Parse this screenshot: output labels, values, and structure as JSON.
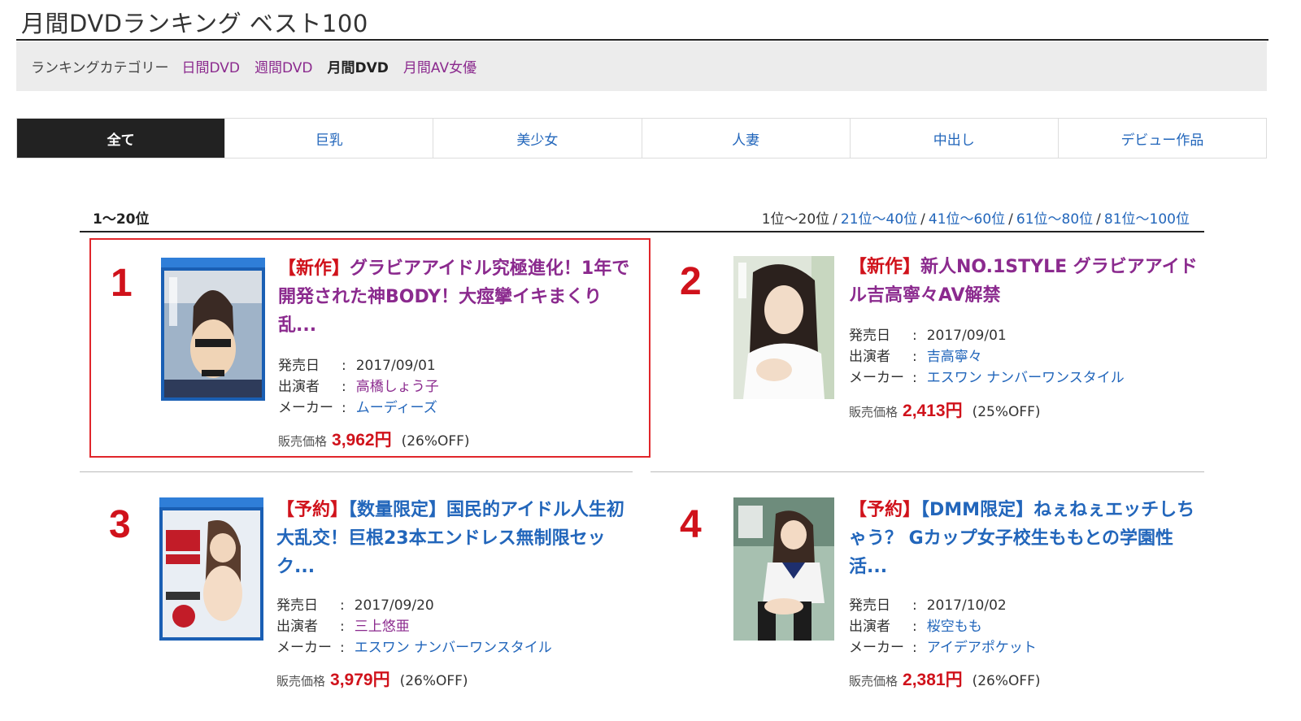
{
  "page": {
    "title": "月間DVDランキング ベスト100"
  },
  "category_bar": {
    "label": "ランキングカテゴリー",
    "items": [
      {
        "label": "日間DVD",
        "active": false
      },
      {
        "label": "週間DVD",
        "active": false
      },
      {
        "label": "月間DVD",
        "active": true
      },
      {
        "label": "月間AV女優",
        "active": false
      }
    ]
  },
  "genre_tabs": [
    {
      "label": "全て",
      "active": true
    },
    {
      "label": "巨乳",
      "active": false
    },
    {
      "label": "美少女",
      "active": false
    },
    {
      "label": "人妻",
      "active": false
    },
    {
      "label": "中出し",
      "active": false
    },
    {
      "label": "デビュー作品",
      "active": false
    }
  ],
  "range": {
    "current": "1〜20位",
    "pages": [
      "1位〜20位",
      "21位〜40位",
      "41位〜60位",
      "61位〜80位",
      "81位〜100位"
    ],
    "separator": "/"
  },
  "labels": {
    "release": "発売日",
    "performer": "出演者",
    "maker": "メーカー",
    "colon": ":",
    "price": "販売価格"
  },
  "items": [
    {
      "rank": "1",
      "tag": "【新作】",
      "title": "グラビアアイドル究極進化！1年で開発された神BODY！大痙攣イキまくり乱...",
      "release": "2017/09/01",
      "performer": "高橋しょう子",
      "maker": "ムーディーズ",
      "price": "3,962円",
      "discount": "(26%OFF)"
    },
    {
      "rank": "2",
      "tag": "【新作】",
      "title": "新人NO.1STYLE グラビアアイドル吉高寧々AV解禁",
      "release": "2017/09/01",
      "performer": "吉高寧々",
      "maker": "エスワン ナンバーワンスタイル",
      "price": "2,413円",
      "discount": "(25%OFF)"
    },
    {
      "rank": "3",
      "tag": "【予約】",
      "title": "【数量限定】国民的アイドル人生初大乱交！巨根23本エンドレス無制限セック...",
      "release": "2017/09/20",
      "performer": "三上悠亜",
      "maker": "エスワン ナンバーワンスタイル",
      "price": "3,979円",
      "discount": "(26%OFF)"
    },
    {
      "rank": "4",
      "tag": "【予約】",
      "title": "【DMM限定】ねぇねぇエッチしちゃう？ Gカップ女子校生ももとの学園性活...",
      "release": "2017/10/02",
      "performer": "桜空もも",
      "maker": "アイデアポケット",
      "price": "2,381円",
      "discount": "(26%OFF)"
    }
  ],
  "colors": {
    "rank_red": "#d0121b",
    "link_purple": "#8b2a8e",
    "link_blue": "#2266bb",
    "highlight_border": "#e0262b"
  }
}
